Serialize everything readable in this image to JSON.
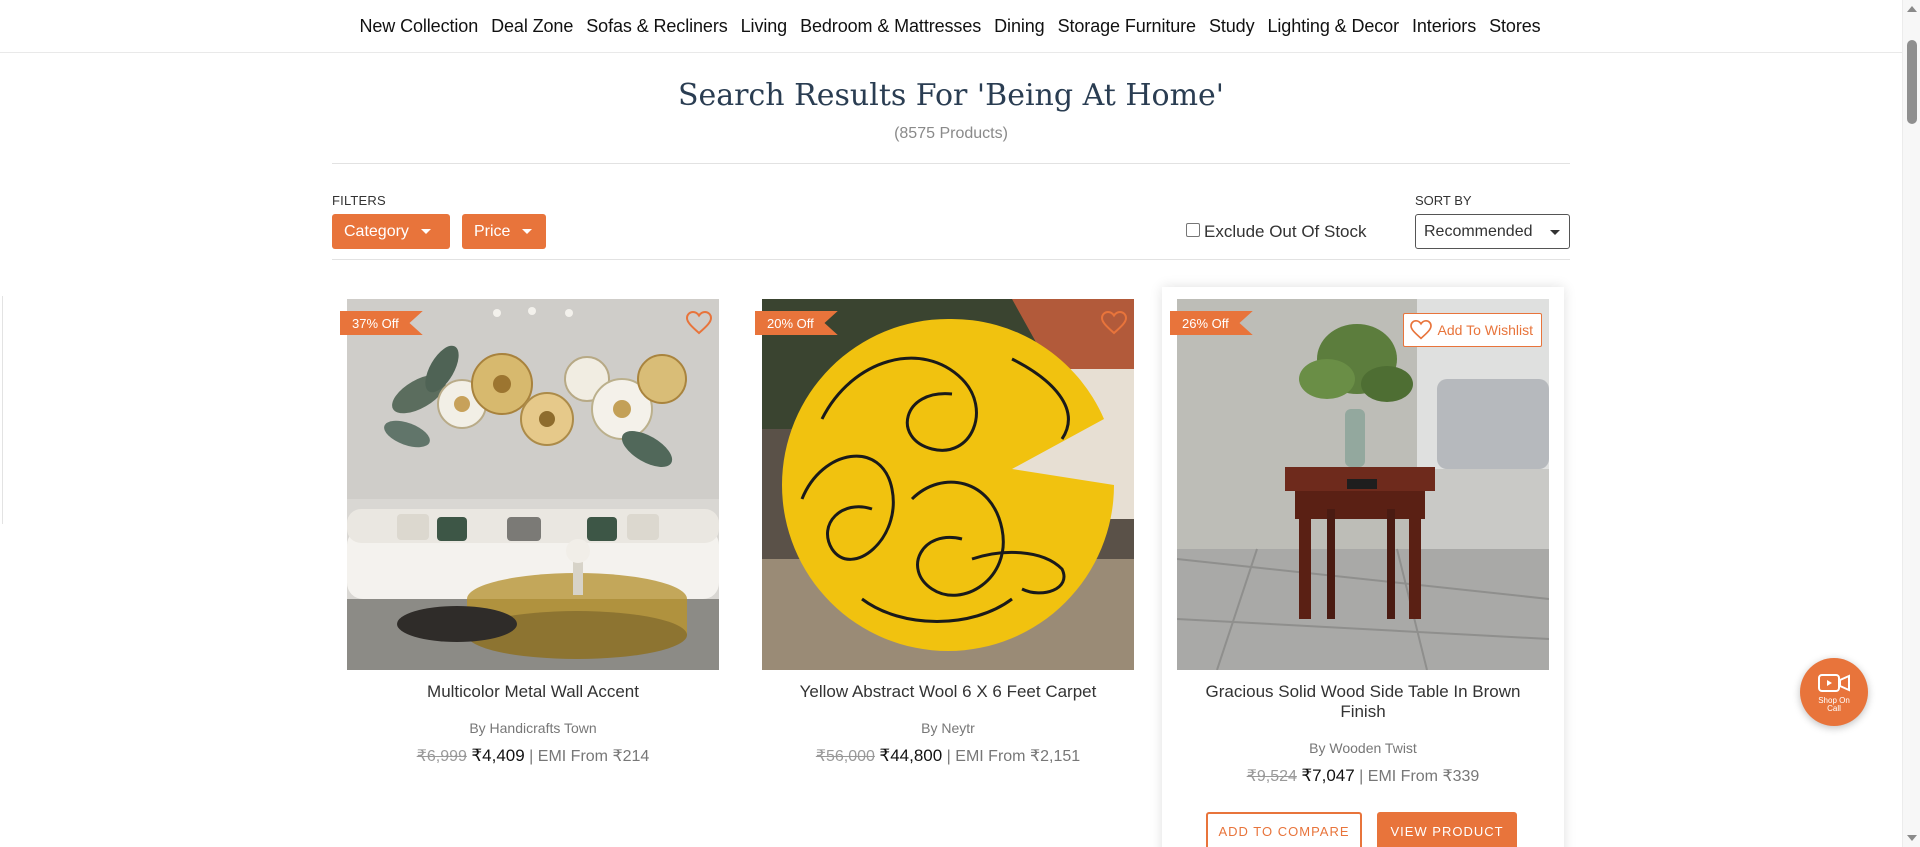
{
  "nav": {
    "items": [
      {
        "label": "New Collection"
      },
      {
        "label": "Deal Zone"
      },
      {
        "label": "Sofas & Recliners"
      },
      {
        "label": "Living"
      },
      {
        "label": "Bedroom & Mattresses"
      },
      {
        "label": "Dining"
      },
      {
        "label": "Storage Furniture"
      },
      {
        "label": "Study"
      },
      {
        "label": "Lighting & Decor"
      },
      {
        "label": "Interiors"
      },
      {
        "label": "Stores"
      }
    ]
  },
  "header": {
    "title": "Search Results For 'Being At Home'",
    "count": "(8575 Products)"
  },
  "filters": {
    "label": "FILTERS",
    "category_label": "Category",
    "price_label": "Price",
    "exclude_label": "Exclude Out Of Stock",
    "exclude_checked": false
  },
  "sort": {
    "label": "SORT BY",
    "selected": "Recommended"
  },
  "products": [
    {
      "discount": "37% Off",
      "title": "Multicolor Metal Wall Accent",
      "brand": "By Handicrafts Town",
      "mrp": "₹6,999",
      "price": "₹4,409",
      "emi": "| EMI From ₹214"
    },
    {
      "discount": "20% Off",
      "title": "Yellow Abstract Wool 6 X 6 Feet Carpet",
      "brand": "By Neytr",
      "mrp": "₹56,000",
      "price": "₹44,800",
      "emi": "| EMI From ₹2,151"
    },
    {
      "discount": "26% Off",
      "title": "Gracious Solid Wood Side Table In Brown Finish",
      "brand": "By Wooden Twist",
      "mrp": "₹9,524",
      "price": "₹7,047",
      "emi": "| EMI From ₹339",
      "wishlist_label": "Add To Wishlist",
      "compare_label": "ADD TO COMPARE",
      "view_label": "VIEW PRODUCT"
    }
  ],
  "floating": {
    "shop_on_call": "Shop On Call"
  },
  "colors": {
    "accent": "#e8743b",
    "title": "#2a3d52"
  }
}
